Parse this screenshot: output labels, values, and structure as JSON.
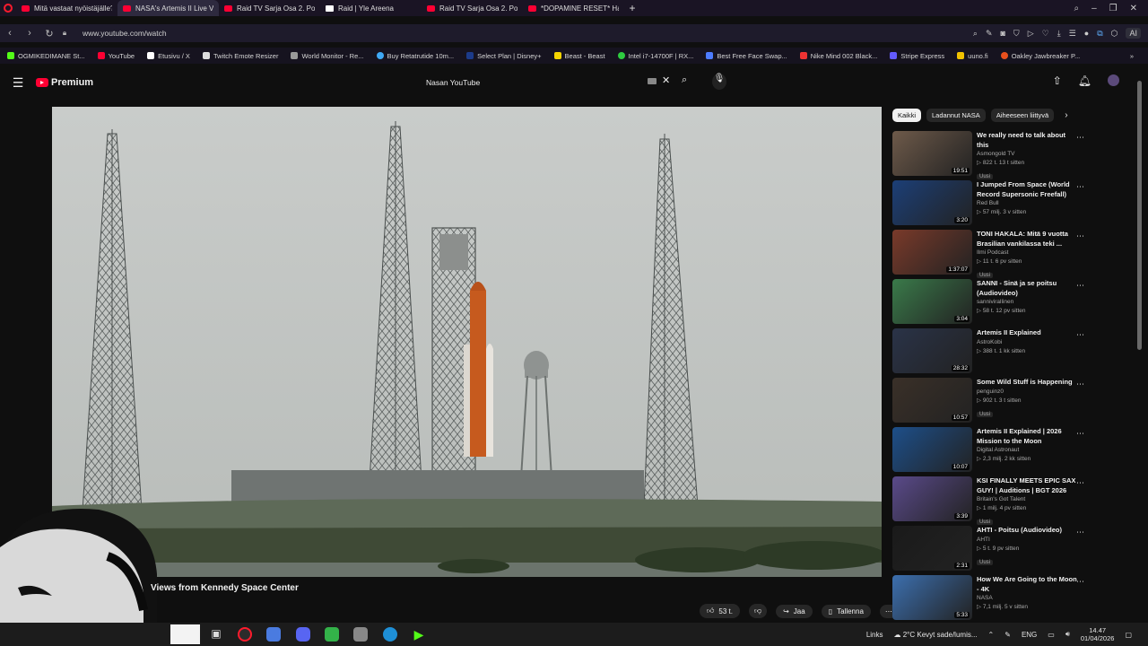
{
  "browser": {
    "tabs": [
      {
        "title": "Mitä vastaat nyöistäjälle? H",
        "icon": "youtube-icon",
        "active": false
      },
      {
        "title": "NASA's Artemis II Live Vie",
        "icon": "youtube-icon",
        "active": true
      },
      {
        "title": "Raid TV Sarja Osa 2. Poliis",
        "icon": "youtube-icon",
        "active": false
      },
      {
        "title": "Raid | Yle Areena",
        "icon": "yle-areena-icon",
        "active": false
      },
      {
        "title": "Raid TV Sarja Osa 2. Poliis",
        "icon": "youtube-icon",
        "active": false
      },
      {
        "title": "*DOPAMINE RESET* Ha",
        "icon": "youtube-icon",
        "active": false
      }
    ],
    "url": "www.youtube.com/watch",
    "extension_label": "AI",
    "bookmarks": [
      "OGMIKEDIMANE St...",
      "YouTube",
      "Etusivu / X",
      "Twitch Emote Resizer",
      "World Monitor - Re...",
      "Buy Retatrutide 10m...",
      "Select Plan | Disney+",
      "Beast - Beast",
      "Intel i7-14700F | RX...",
      "Best Free Face Swap...",
      "Nike Mind 002 Black...",
      "Stripe Express",
      "uuno.fi",
      "Oakley Jawbreaker P..."
    ]
  },
  "youtube": {
    "logo_text": "Premium",
    "search_value": "Nasan YouTube",
    "video_title": "Views from Kennedy Space Center",
    "actions": {
      "likes": "53 t.",
      "share": "Jaa",
      "save": "Tallenna"
    },
    "chips": [
      "Kaikki",
      "Ladannut NASA",
      "Aiheeseen liittyvä"
    ],
    "recommendations": [
      {
        "title": "We really need to talk about this",
        "channel": "Asmongold TV",
        "stats": "822 t.   13 t sitten",
        "badge": "Uusi",
        "duration": "19:51"
      },
      {
        "title": "I Jumped From Space (World Record Supersonic Freefall)",
        "channel": "Red Bull",
        "stats": "57 milj.   3 v sitten",
        "badge": "",
        "duration": "3:20"
      },
      {
        "title": "TONI HAKALA: Mitä 9 vuotta Brasilian vankilassa teki ...",
        "channel": "Ilmi Podcast",
        "stats": "11 t.   6 pv sitten",
        "badge": "Uusi",
        "duration": "1:37:07"
      },
      {
        "title": "SANNI - Sinä ja se poitsu (Audiovideo)",
        "channel": "sannivirallinen",
        "stats": "58 t.   12 pv sitten",
        "badge": "",
        "duration": "3:04"
      },
      {
        "title": "Artemis II Explained",
        "channel": "AstroKobi",
        "stats": "388 t.   1 kk sitten",
        "badge": "",
        "duration": "28:32"
      },
      {
        "title": "Some Wild Stuff is Happening",
        "channel": "penguinz0",
        "stats": "902 t.   3 t sitten",
        "badge": "Uusi",
        "duration": "10:57"
      },
      {
        "title": "Artemis II Explained | 2026 Mission to the Moon",
        "channel": "Digital Astronaut",
        "stats": "2,3 milj.   2 kk sitten",
        "badge": "",
        "duration": "10:07"
      },
      {
        "title": "KSI FINALLY MEETS EPIC SAX GUY! | Auditions | BGT 2026",
        "channel": "Britain's Got Talent",
        "stats": "1 milj.   4 pv sitten",
        "badge": "Uusi",
        "duration": "3:39"
      },
      {
        "title": "AHTI - Poitsu (Audiovideo)",
        "channel": "AHTI",
        "stats": "5 t.   9 pv sitten",
        "badge": "Uusi",
        "duration": "2:31"
      },
      {
        "title": "How We Are Going to the Moon - 4K",
        "channel": "NASA",
        "stats": "7,1 milj.   5 v sitten",
        "badge": "",
        "duration": "5:33"
      }
    ]
  },
  "taskbar": {
    "links_label": "Links",
    "weather": "2°C  Kevyt sade/lumis...",
    "language": "ENG",
    "time": "14.47",
    "date": "01/04/2026"
  },
  "colors": {
    "youtube_red": "#ff0033",
    "opera_red": "#ff1b2d",
    "background": "#0f0f0f"
  }
}
